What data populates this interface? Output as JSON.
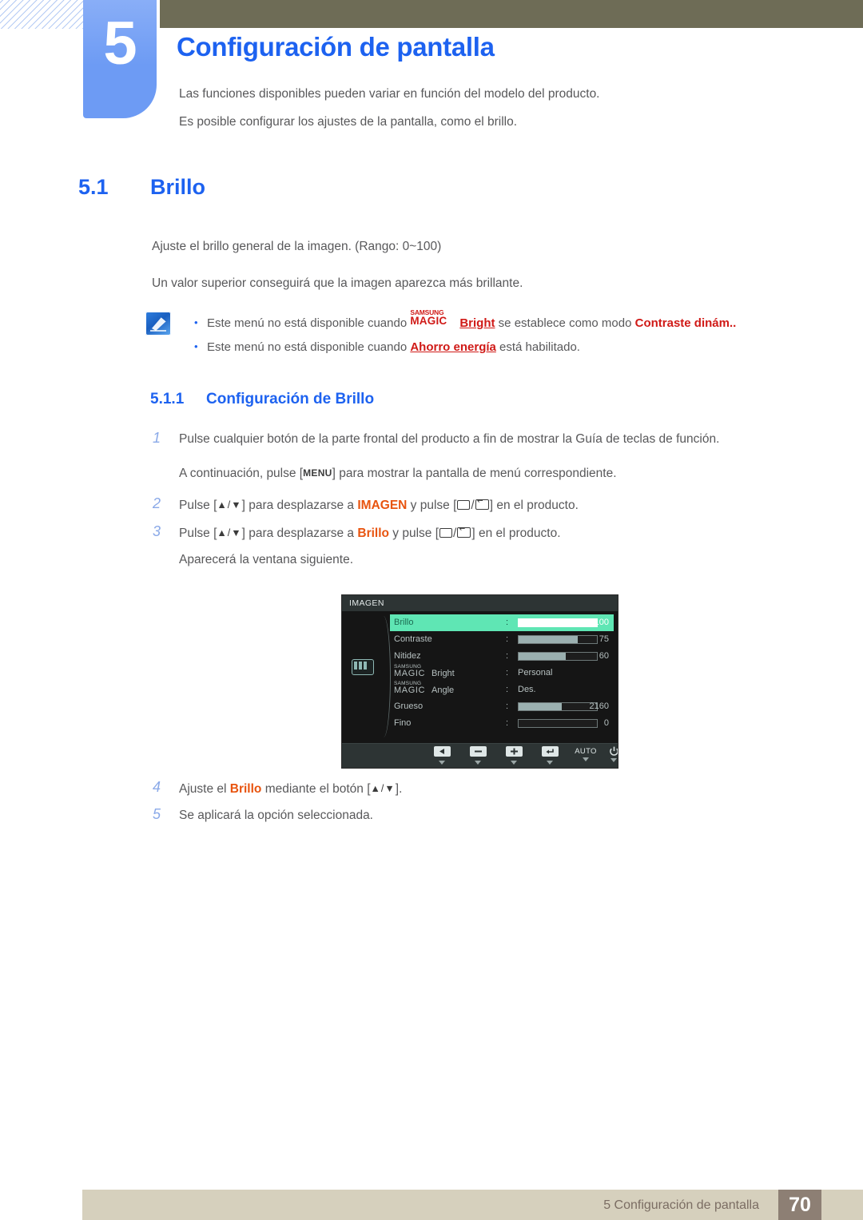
{
  "header": {
    "chapter_number": "5",
    "chapter_title": "Configuración de pantalla",
    "lead_1": "Las funciones disponibles pueden variar en función del modelo del producto.",
    "lead_2": "Es posible configurar los ajustes de la pantalla, como el brillo."
  },
  "section": {
    "number": "5.1",
    "title": "Brillo",
    "body_1": "Ajuste el brillo general de la imagen. (Rango: 0~100)",
    "body_2": "Un valor superior conseguirá que la imagen aparezca más brillante."
  },
  "note": {
    "bullet_char": "•",
    "row1_pre": "Este menú no está disponible cuando ",
    "row1_samsung": "SAMSUNG",
    "row1_magic": "MAGIC",
    "row1_bright": "Bright",
    "row1_mid": " se establece como modo ",
    "row1_mode": "Contraste dinám..",
    "row2_pre": "Este menú no está disponible cuando ",
    "row2_link": "Ahorro energía",
    "row2_post": " está habilitado."
  },
  "subsection": {
    "number": "5.1.1",
    "title": "Configuración de Brillo"
  },
  "steps": {
    "s1_num": "1",
    "s1_text": "Pulse cualquier botón de la parte frontal del producto a fin de mostrar la Guía de teclas de función.",
    "s1_sub_pre": "A continuación, pulse [",
    "s1_sub_key": "MENU",
    "s1_sub_post": "] para mostrar la pantalla de menú correspondiente.",
    "s2_num": "2",
    "s2_pre": "Pulse [",
    "s2_keys": "▲/▼",
    "s2_mid": "] para desplazarse a ",
    "s2_target": "IMAGEN",
    "s2_mid2": " y pulse [",
    "s2_post": "] en el producto.",
    "s3_num": "3",
    "s3_pre": "Pulse [",
    "s3_keys": "▲/▼",
    "s3_mid": "] para desplazarse a ",
    "s3_target": "Brillo",
    "s3_mid2": " y pulse [",
    "s3_post": "] en el producto.",
    "s3_sub": "Aparecerá la ventana siguiente.",
    "s4_num": "4",
    "s4_pre": "Ajuste el ",
    "s4_target": "Brillo",
    "s4_mid": " mediante el botón [",
    "s4_keys": "▲/▼",
    "s4_post": "].",
    "s5_num": "5",
    "s5_text": "Se aplicará la opción seleccionada."
  },
  "osd": {
    "title": "IMAGEN",
    "rows": [
      {
        "label": "Brillo",
        "colon": ":",
        "type": "slider",
        "value": "100",
        "fill": 100,
        "selected": true
      },
      {
        "label": "Contraste",
        "colon": ":",
        "type": "slider",
        "value": "75",
        "fill": 75,
        "selected": false
      },
      {
        "label": "Nitidez",
        "colon": ":",
        "type": "slider",
        "value": "60",
        "fill": 60,
        "selected": false
      },
      {
        "label": "Bright",
        "colon": ":",
        "type": "magic",
        "value": "Personal",
        "selected": false
      },
      {
        "label": "Angle",
        "colon": ":",
        "type": "magic",
        "value": "Des.",
        "selected": false
      },
      {
        "label": "Grueso",
        "colon": ":",
        "type": "slider",
        "value": "2160",
        "fill": 55,
        "selected": false
      },
      {
        "label": "Fino",
        "colon": ":",
        "type": "slider",
        "value": "0",
        "fill": 0,
        "selected": false
      }
    ],
    "magic_samsung": "SAMSUNG",
    "magic_word": "MAGIC",
    "side_icon": "picture-icon",
    "footer_keys": [
      {
        "name": "back-key",
        "kind": "icon-back"
      },
      {
        "name": "minus-key",
        "kind": "icon-minus"
      },
      {
        "name": "plus-key",
        "kind": "icon-plus"
      },
      {
        "name": "enter-key",
        "kind": "icon-enter"
      },
      {
        "name": "auto-key",
        "kind": "text",
        "label": "AUTO"
      },
      {
        "name": "power-key",
        "kind": "icon-power"
      }
    ]
  },
  "footer": {
    "text": "5 Configuración de pantalla",
    "page": "70"
  },
  "colors": {
    "accent_blue": "#1d62f0",
    "tab_blue": "#6d9bf4",
    "olive": "#6e6c56",
    "red": "#d01a17",
    "orange": "#e8540f",
    "osd_green": "#5fe6b4",
    "footer_bar": "#d6d0bd",
    "footer_page": "#8d7f74"
  }
}
